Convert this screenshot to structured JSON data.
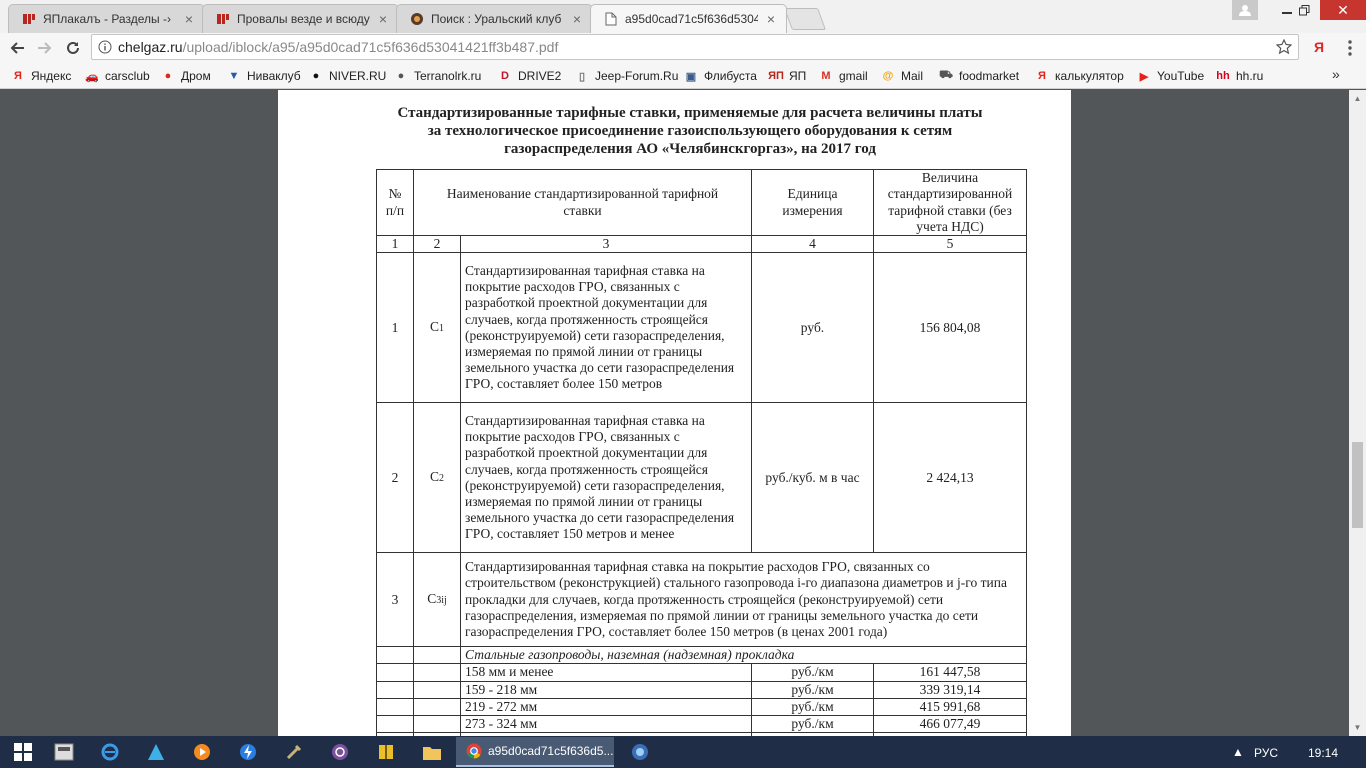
{
  "browser": {
    "tabs": [
      {
        "title": "ЯПлакалъ - Разделы -›",
        "icon": "yaplakal-icon",
        "active": false
      },
      {
        "title": "Провалы везде и всюду",
        "icon": "yaplakal-icon",
        "active": false
      },
      {
        "title": "Поиск : Уральский клуб",
        "icon": "club-icon",
        "active": false
      },
      {
        "title": "a95d0cad71c5f636d5304",
        "icon": "document-icon",
        "active": true
      }
    ],
    "url_host": "chelgaz.ru",
    "url_path": "/upload/iblock/a95/a95d0cad71c5f636d53041421ff3b487.pdf",
    "extension_label": "Я",
    "bookmarks": [
      {
        "label": "Яндекс",
        "icon": "yandex-icon",
        "glyph": "Я",
        "color": "#e52620"
      },
      {
        "label": "carsclub",
        "icon": "car-icon",
        "glyph": "🚗",
        "color": "#333333"
      },
      {
        "label": "Дром",
        "icon": "drom-icon",
        "glyph": "●",
        "color": "#d62b1f"
      },
      {
        "label": "Ниваклуб",
        "icon": "nivaclub-icon",
        "glyph": "▼",
        "color": "#2a5aa8"
      },
      {
        "label": "NIVER.RU",
        "icon": "niver-icon",
        "glyph": "●",
        "color": "#111111"
      },
      {
        "label": "Terranolrk.ru",
        "icon": "terrano-icon",
        "glyph": "●",
        "color": "#555555"
      },
      {
        "label": "DRIVE2",
        "icon": "drive2-icon",
        "glyph": "D",
        "color": "#c4142d"
      },
      {
        "label": "Jeep-Forum.Ru",
        "icon": "page-icon",
        "glyph": "▯",
        "color": "#777777"
      },
      {
        "label": "Флибуста",
        "icon": "flibusta-icon",
        "glyph": "▣",
        "color": "#3a5b8c"
      },
      {
        "label": "ЯП",
        "icon": "yaplakal-icon",
        "glyph": "ЯП",
        "color": "#b8271f"
      },
      {
        "label": "gmail",
        "icon": "gmail-icon",
        "glyph": "M",
        "color": "#d93025"
      },
      {
        "label": "Mail",
        "icon": "mail-icon",
        "glyph": "@",
        "color": "#f0a30a"
      },
      {
        "label": "foodmarket",
        "icon": "cart-icon",
        "glyph": "⛟",
        "color": "#555555"
      },
      {
        "label": "калькулятор",
        "icon": "yandex-icon",
        "glyph": "Я",
        "color": "#e52620"
      },
      {
        "label": "YouTube",
        "icon": "youtube-icon",
        "glyph": "▶",
        "color": "#e62117"
      },
      {
        "label": "hh.ru",
        "icon": "hh-icon",
        "glyph": "hh",
        "color": "#d6001c"
      }
    ],
    "bookmarks_more": "»"
  },
  "document": {
    "title_lines": [
      "Стандартизированные тарифные ставки, применяемые для расчета величины платы",
      "за технологическое присоединение газоиспользующего оборудования к сетям",
      "газораспределения АО «Челябинскгоргаз», на 2017 год"
    ],
    "header": {
      "num": "№\nп/п",
      "name": "Наименование стандартизированной тарифной ставки",
      "unit": "Единица измерения",
      "value": "Величина стандартизированной тарифной ставки (без учета НДС)"
    },
    "col_numbers": [
      "1",
      "2",
      "3",
      "4",
      "5"
    ],
    "rows": [
      {
        "num": "1",
        "code": "C",
        "code_sub": "1",
        "desc": "Стандартизированная тарифная ставка на покрытие расходов ГРО, связанных с разработкой проектной документации для случаев, когда протяженность строящейся (реконструируемой) сети газораспределения, измеряемая по прямой линии от границы земельного участка до сети газораспределения ГРО, составляет более 150 метров",
        "unit": "руб.",
        "value": "156 804,08"
      },
      {
        "num": "2",
        "code": "C",
        "code_sub": "2",
        "desc": "Стандартизированная тарифная ставка на покрытие расходов ГРО, связанных с разработкой проектной документации для случаев, когда протяженность строящейся (реконструируемой) сети газораспределения, измеряемая по прямой линии от границы земельного участка до сети газораспределения ГРО, составляет 150 метров и менее",
        "unit": "руб./куб. м в час",
        "value": "2 424,13"
      }
    ],
    "row3": {
      "num": "3",
      "code": "C",
      "code_sub": "3ij",
      "desc": "Стандартизированная тарифная ставка на покрытие расходов ГРО, связанных со строительством (реконструкцией) стального газопровода i-го диапазона диаметров и j-го типа прокладки для случаев, когда протяженность строящейся (реконструируемой) сети газораспределения, измеряемая по прямой линии от границы земельного участка до сети газораспределения ГРО, составляет более 150 метров (в ценах 2001 года)"
    },
    "section_label": "Стальные газопроводы, наземная (надземная) прокладка",
    "sub_rows": [
      {
        "name": "158 мм и менее",
        "unit": "руб./км",
        "value": "161 447,58"
      },
      {
        "name": "159 - 218 мм",
        "unit": "руб./км",
        "value": "339 319,14"
      },
      {
        "name": "219 - 272 мм",
        "unit": "руб./км",
        "value": "415 991,68"
      },
      {
        "name": "273 - 324 мм",
        "unit": "руб./км",
        "value": "466 077,49"
      }
    ]
  },
  "taskbar": {
    "active_window_title": "a95d0cad71c5f636d5...",
    "language": "РУС",
    "clock": "19:14"
  }
}
